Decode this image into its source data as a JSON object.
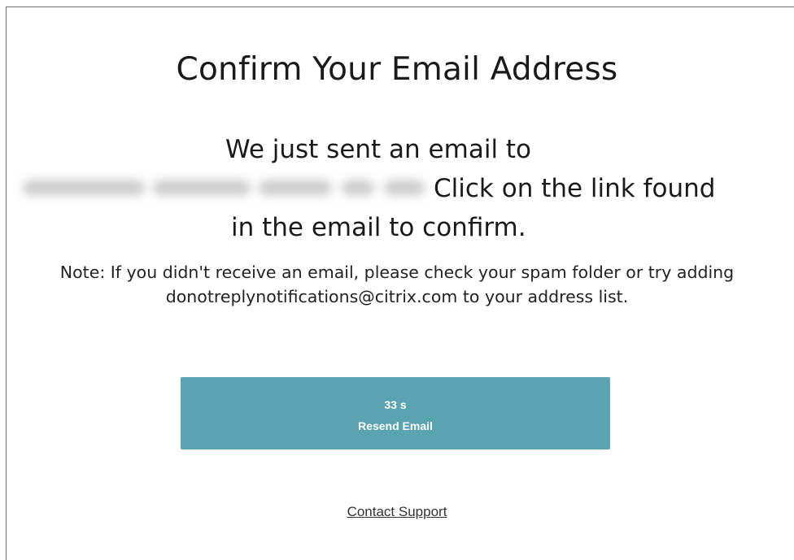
{
  "page": {
    "title": "Confirm Your Email Address",
    "message_line1": "We just sent an email to",
    "message_line2": "Click on the link found",
    "message_line3": "in the email to confirm.",
    "note": "Note: If you didn't receive an email, please check your spam folder or try adding donotreplynotifications@citrix.com to your address list."
  },
  "resend": {
    "countdown": "33 s",
    "label": "Resend Email"
  },
  "contact_support_label": "Contact Support",
  "colors": {
    "button_bg": "#5aa3b0",
    "button_text": "#ffffff",
    "text": "#1a1a1a"
  }
}
